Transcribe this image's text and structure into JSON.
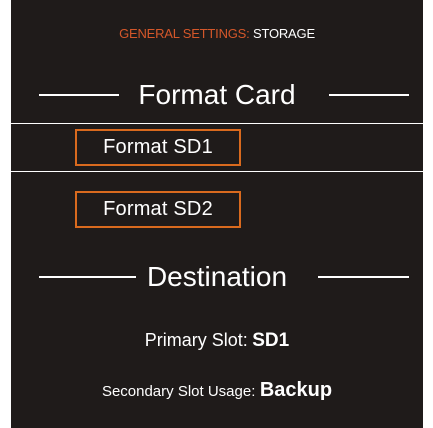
{
  "header": {
    "category": "GENERAL SETTINGS:",
    "page": "STORAGE"
  },
  "format_section": {
    "title": "Format Card",
    "items": [
      {
        "label": "Format SD1",
        "selected": true
      },
      {
        "label": "Format SD2",
        "selected": false
      }
    ]
  },
  "destination_section": {
    "title": "Destination",
    "primary_slot_label": "Primary Slot:",
    "primary_slot_value": "SD1",
    "secondary_usage_label": "Secondary Slot Usage:",
    "secondary_usage_value": "Backup"
  },
  "colors": {
    "panel_bg": "#1f1b1a",
    "accent": "#d4572a",
    "button_border": "#d96a1e",
    "text": "#ffffff"
  }
}
